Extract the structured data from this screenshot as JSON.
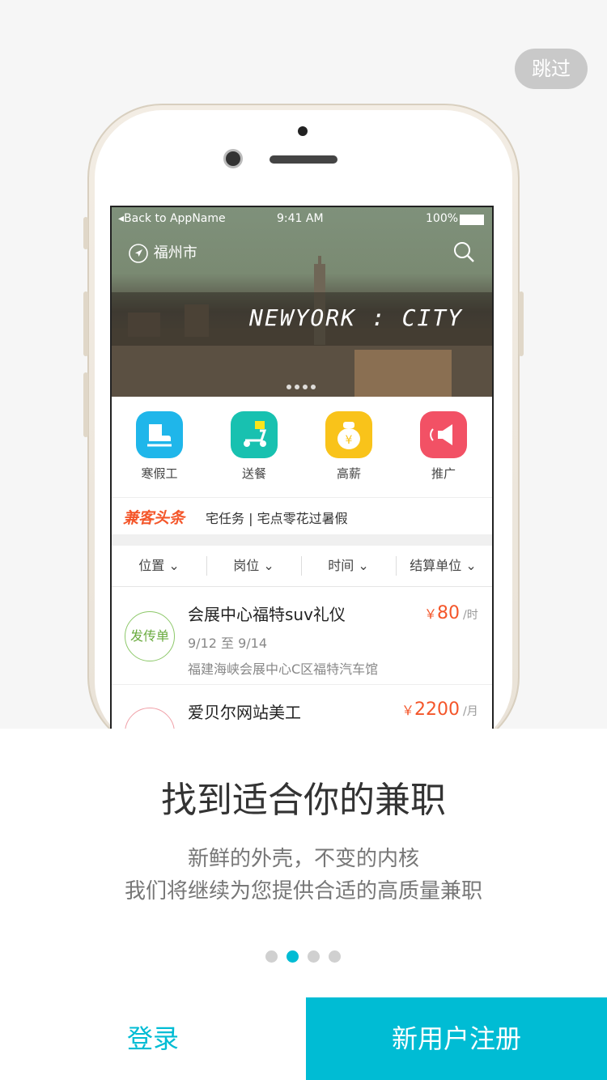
{
  "skip_label": "跳过",
  "status_bar": {
    "back": "◂Back to AppName",
    "time": "9:41 AM",
    "battery": "100%"
  },
  "location": "福州市",
  "banner_text": "NEWYORK : CITY",
  "categories": [
    {
      "label": "寒假工",
      "icon": "skate-icon",
      "color": "#1fb6ea"
    },
    {
      "label": "送餐",
      "icon": "scooter-icon",
      "color": "#18c1b0"
    },
    {
      "label": "高薪",
      "icon": "money-bag-icon",
      "color": "#f9c31a"
    },
    {
      "label": "推广",
      "icon": "megaphone-icon",
      "color": "#f25165"
    }
  ],
  "news": {
    "brand": "兼客头条",
    "text": "宅任务 | 宅点零花过暑假"
  },
  "filters": [
    "位置",
    "岗位",
    "时间",
    "结算单位"
  ],
  "jobs": [
    {
      "stamp": "发传单",
      "title": "会展中心福特suv礼仪",
      "currency": "￥",
      "price": "80",
      "unit": "/时",
      "date": "9/12 至 9/14",
      "address": "福建海峡会展中心C区福特汽车馆"
    },
    {
      "stamp": "",
      "title": "爱贝尔网站美工",
      "currency": "￥",
      "price": "2200",
      "unit": "/月",
      "date": "",
      "address": ""
    }
  ],
  "headline": "找到适合你的兼职",
  "subtitle_1": "新鲜的外壳，不变的内核",
  "subtitle_2": "我们将继续为您提供合适的高质量兼职",
  "page_dots": {
    "count": 4,
    "active": 1
  },
  "login_label": "登录",
  "register_label": "新用户注册",
  "colors": {
    "accent": "#00bcd4",
    "price": "#f4562a",
    "skip_bg": "#c9c9c9"
  }
}
